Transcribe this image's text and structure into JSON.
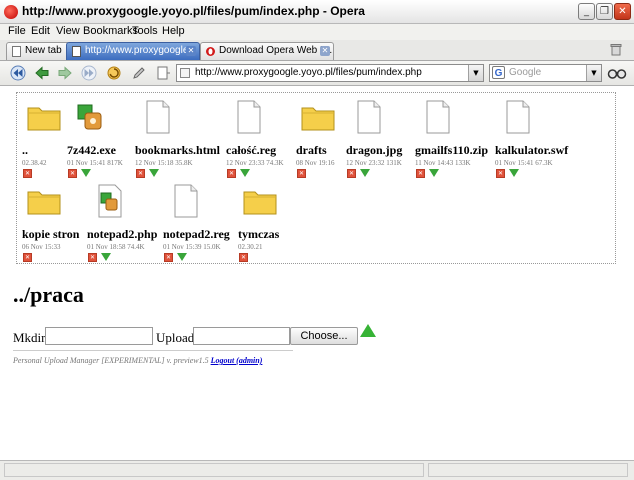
{
  "window": {
    "title": "http://www.proxygoogle.yoyo.pl/files/pum/index.php - Opera",
    "min_label": "_",
    "restore_label": "❐",
    "close_label": "✕"
  },
  "menu": [
    "File",
    "Edit",
    "View",
    "Bookmarks",
    "Tools",
    "Help"
  ],
  "tabs": [
    {
      "label": "New tab",
      "active": false
    },
    {
      "label": "http://www.proxygoogle...",
      "active": true
    },
    {
      "label": "Download Opera Web Br...",
      "active": false
    }
  ],
  "address": {
    "value": "http://www.proxygoogle.yoyo.pl/files/pum/index.php"
  },
  "search": {
    "placeholder": "Google"
  },
  "colors": {
    "accent": "#3c6cbf",
    "delete": "#e0523b",
    "download": "#39a53a"
  },
  "files": [
    {
      "name": "..",
      "meta": "02.38.42",
      "icon": "folder-icon",
      "download": false
    },
    {
      "name": "7z442.exe",
      "meta": "01 Nov 15:41  817K",
      "icon": "exe-icon",
      "download": true
    },
    {
      "name": "bookmarks.html",
      "meta": "12 Nov 15:18  35.8K",
      "icon": "file-icon",
      "download": true
    },
    {
      "name": "całość.reg",
      "meta": "12 Nov 23:33  74.3K",
      "icon": "file-icon",
      "download": true
    },
    {
      "name": "drafts",
      "meta": "08 Nov 19:16",
      "icon": "folder-icon",
      "download": false
    },
    {
      "name": "dragon.jpg",
      "meta": "12 Nov 23:32  131K",
      "icon": "file-icon",
      "download": true
    },
    {
      "name": "gmailfs110.zip",
      "meta": "11 Nov 14:43  133K",
      "icon": "file-icon",
      "download": true
    },
    {
      "name": "kalkulator.swf",
      "meta": "01 Nov 15:41  67.3K",
      "icon": "file-icon",
      "download": true
    },
    {
      "name": "kopie stron",
      "meta": "06 Nov 15:33",
      "icon": "folder-icon",
      "download": false
    },
    {
      "name": "notepad2.php",
      "meta": "01 Nov 18:58  74.4K",
      "icon": "exe-icon",
      "download": true
    },
    {
      "name": "notepad2.reg",
      "meta": "01 Nov 15:39  15.0K",
      "icon": "file-icon",
      "download": true
    },
    {
      "name": "tymczas",
      "meta": "02.30.21",
      "icon": "folder-icon",
      "download": false
    }
  ],
  "page": {
    "heading": "../praca",
    "mkdir_label": "Mkdir",
    "upload_label": "Upload",
    "choose_label": "Choose...",
    "footer_text": "Personal Upload Manager [EXPERIMENTAL] v. preview1.5 ",
    "logout_label": "Logout (admin)"
  }
}
